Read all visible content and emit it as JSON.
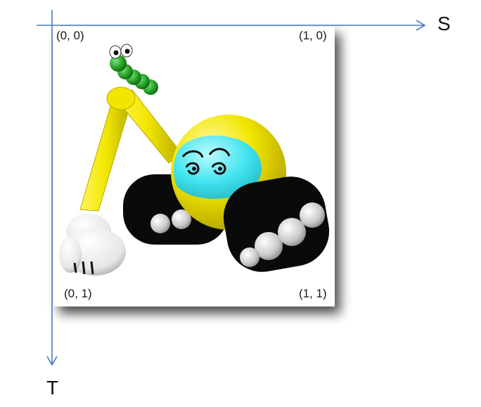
{
  "axes": {
    "horizontal_label": "S",
    "vertical_label": "T",
    "color": "#4a7ab8"
  },
  "corners": {
    "top_left": "(0, 0)",
    "top_right": "(1, 0)",
    "bottom_left": "(0, 1)",
    "bottom_right": "(1, 1)"
  },
  "texture": {
    "subject": "cartoon excavator robot with a green caterpillar",
    "colors": {
      "body_yellow": "#f2e600",
      "visor_cyan": "#3fe3ee",
      "tracks_black": "#0a0a0a",
      "wheels_gray": "#b9b9b9",
      "worm_green": "#1f9a1f",
      "glove_white": "#f5f5f5"
    }
  }
}
